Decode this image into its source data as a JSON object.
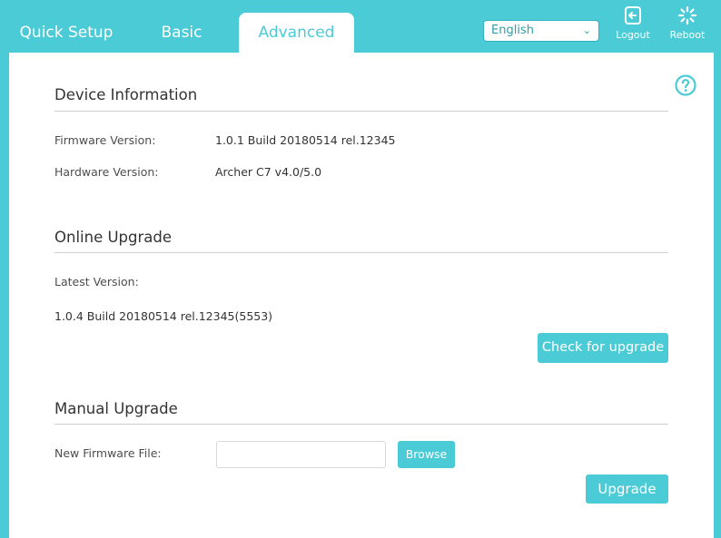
{
  "nav": {
    "tabs": [
      {
        "label": "Quick Setup"
      },
      {
        "label": "Basic"
      },
      {
        "label": "Advanced"
      }
    ],
    "language": "English",
    "logout_label": "Logout",
    "reboot_label": "Reboot"
  },
  "device_info": {
    "title": "Device Information",
    "firmware_label": "Firmware Version:",
    "firmware_value": "1.0.1 Build 20180514 rel.12345",
    "hardware_label": "Hardware Version:",
    "hardware_value": "Archer C7 v4.0/5.0"
  },
  "online_upgrade": {
    "title": "Online Upgrade",
    "latest_label": "Latest Version:",
    "latest_value": "1.0.4 Build 20180514 rel.12345(5553)",
    "check_button": "Check for upgrade"
  },
  "manual_upgrade": {
    "title": "Manual Upgrade",
    "file_label": "New Firmware File:",
    "file_value": "",
    "browse_button": "Browse",
    "upgrade_button": "Upgrade"
  },
  "colors": {
    "accent": "#4acbd6",
    "background": "#ffffff"
  }
}
